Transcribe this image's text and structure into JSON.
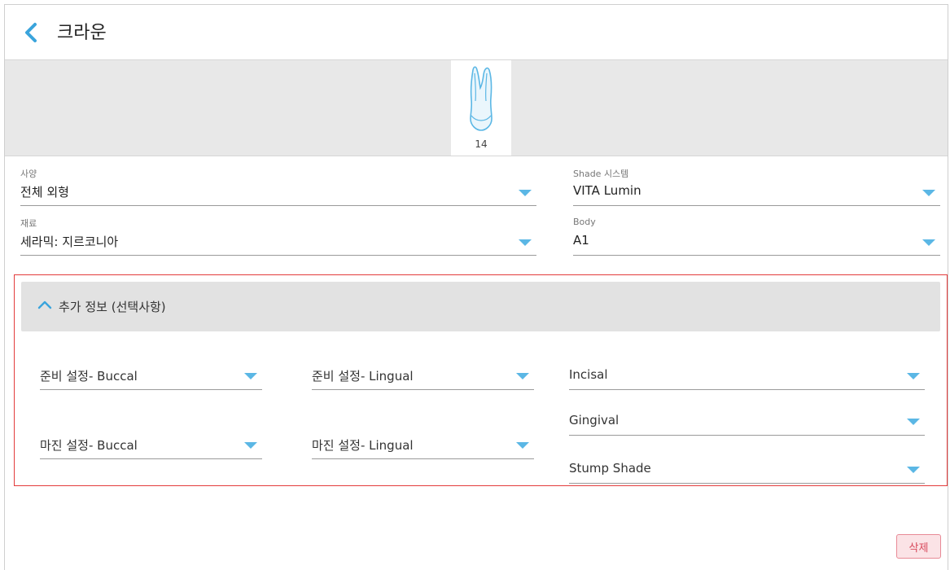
{
  "header": {
    "title": "크라운"
  },
  "tooth": {
    "number": "14"
  },
  "fields": {
    "spec_label": "사양",
    "spec_value": "전체 외형",
    "material_label": "재료",
    "material_value": "세라믹: 지르코니아",
    "shade_system_label": "Shade 시스템",
    "shade_system_value": "VITA Lumin",
    "body_label": "Body",
    "body_value": "A1"
  },
  "optional": {
    "title": "추가 정보 (선택사항)",
    "prep_buccal": "준비 설정- Buccal",
    "prep_lingual": "준비 설정- Lingual",
    "margin_buccal": "마진 설정- Buccal",
    "margin_lingual": "마진 설정- Lingual",
    "incisal": "Incisal",
    "gingival": "Gingival",
    "stump_shade": "Stump Shade"
  },
  "actions": {
    "delete_label": "삭제"
  },
  "colors": {
    "accent": "#5bb7e5",
    "highlight_border": "#e33b3b",
    "delete_text": "#d84a5c"
  }
}
